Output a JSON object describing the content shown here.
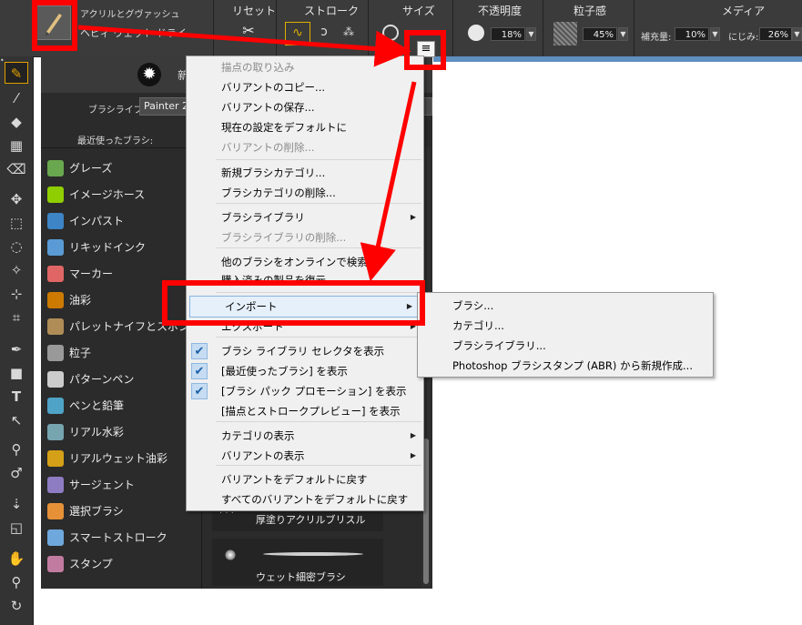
{
  "topbar": {
    "brush_category": "アクリルとグヴァッシュ",
    "brush_variant": "ヘビィ ウェット ドライ",
    "reset_label": "リセット",
    "stroke_label": "ストローク",
    "size_label": "サイズ",
    "opacity_label": "不透明度",
    "opacity_value": "18%",
    "grain_label": "粒子感",
    "grain_value": "45%",
    "media_label": "メディア",
    "fill_label": "補充量:",
    "fill_value": "10%",
    "bleed_label": "にじみ:",
    "bleed_value": "26%"
  },
  "panel": {
    "title": "新",
    "library_label": "ブラシライブラリ:",
    "library_value": "Painter 2",
    "recent_label": "最近使ったブラシ:",
    "categories": [
      {
        "label": "グレーズ",
        "color": "#6aa84f"
      },
      {
        "label": "イメージホース",
        "color": "#8fce00"
      },
      {
        "label": "インパスト",
        "color": "#3d85c6"
      },
      {
        "label": "リキッドインク",
        "color": "#5a9bd5"
      },
      {
        "label": "マーカー",
        "color": "#e06666"
      },
      {
        "label": "油彩",
        "color": "#cc7a00"
      },
      {
        "label": "パレットナイフとスポンジ",
        "color": "#b08d57"
      },
      {
        "label": "粒子",
        "color": "#999999"
      },
      {
        "label": "パターンペン",
        "color": "#cccccc"
      },
      {
        "label": "ペンと鉛筆",
        "color": "#4fa3c7"
      },
      {
        "label": "リアル水彩",
        "color": "#76a5af"
      },
      {
        "label": "リアルウェット油彩",
        "color": "#d4a017"
      },
      {
        "label": "サージェント",
        "color": "#8e7cc3"
      },
      {
        "label": "選択ブラシ",
        "color": "#e69138"
      },
      {
        "label": "スマートストローク",
        "color": "#6fa8dc"
      },
      {
        "label": "スタンプ",
        "color": "#c27ba0"
      }
    ],
    "variants": [
      {
        "label": "厚塗りアクリルブリスル"
      },
      {
        "label": "ウェット細密ブラシ"
      }
    ]
  },
  "menu": {
    "items": [
      {
        "label": "描点の取り込み",
        "disabled": true
      },
      {
        "label": "バリアントのコピー...",
        "disabled": false
      },
      {
        "label": "バリアントの保存...",
        "disabled": false
      },
      {
        "label": "現在の設定をデフォルトに",
        "disabled": false
      },
      {
        "label": "バリアントの削除...",
        "disabled": true
      },
      {
        "label": "新規ブラシカテゴリ...",
        "disabled": false
      },
      {
        "label": "ブラシカテゴリの削除...",
        "disabled": false
      },
      {
        "label": "ブラシライブラリ",
        "disabled": false
      },
      {
        "label": "ブラシライブラリの削除...",
        "disabled": true
      },
      {
        "label": "他のブラシをオンラインで検索...",
        "disabled": false
      },
      {
        "label": "購入済みの製品を復元",
        "disabled": false
      },
      {
        "label": "インポート",
        "disabled": false
      },
      {
        "label": "エクスポート",
        "disabled": false
      },
      {
        "label": "ブラシ ライブラリ セレクタを表示",
        "checked": true
      },
      {
        "label": "[最近使ったブラシ] を表示",
        "checked": true
      },
      {
        "label": "[ブラシ パック プロモーション] を表示",
        "checked": true
      },
      {
        "label": "[描点とストロークプレビュー] を表示",
        "checked": false
      },
      {
        "label": "カテゴリの表示",
        "disabled": false
      },
      {
        "label": "バリアントの表示",
        "disabled": false
      },
      {
        "label": "バリアントをデフォルトに戻す",
        "disabled": false
      },
      {
        "label": "すべてのバリアントをデフォルトに戻す",
        "disabled": false
      }
    ]
  },
  "submenu": {
    "items": [
      {
        "label": "ブラシ..."
      },
      {
        "label": "カテゴリ..."
      },
      {
        "label": "ブラシライブラリ..."
      },
      {
        "label": "Photoshop ブラシスタンプ (ABR) から新規作成..."
      }
    ]
  },
  "colors": {
    "highlight": "#ff0000",
    "menu_bg": "#f0f0f0",
    "check_bg": "#c5dcf2"
  }
}
